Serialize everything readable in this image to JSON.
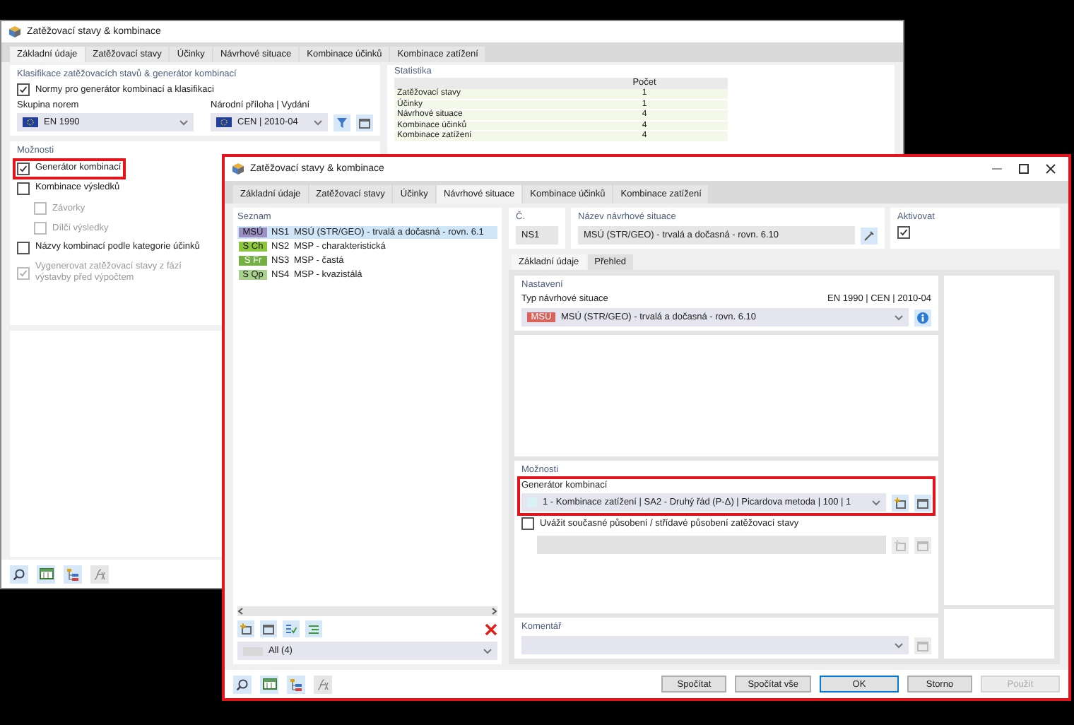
{
  "back_window": {
    "title": "Zatěžovací stavy & kombinace",
    "tabs": [
      {
        "label": "Základní údaje",
        "selected": true
      },
      {
        "label": "Zatěžovací stavy",
        "selected": false
      },
      {
        "label": "Účinky",
        "selected": false
      },
      {
        "label": "Návrhové situace",
        "selected": false
      },
      {
        "label": "Kombinace účinků",
        "selected": false
      },
      {
        "label": "Kombinace zatížení",
        "selected": false
      }
    ],
    "classification": {
      "heading": "Klasifikace zatěžovacích stavů & generátor kombinací",
      "norms": {
        "label": "Normy pro generátor kombinací a klasifikaci",
        "checked": true
      },
      "standard_group": {
        "label": "Skupina norem",
        "value": "EN 1990"
      },
      "national_annex": {
        "label": "Národní příloha | Vydání",
        "value": "CEN | 2010-04"
      }
    },
    "options": {
      "heading": "Možnosti",
      "items": [
        {
          "label": "Generátor kombinací",
          "checked": true,
          "disabled": false,
          "highlighted": true
        },
        {
          "label": "Kombinace výsledků",
          "checked": false,
          "disabled": false,
          "highlighted": false,
          "children": [
            {
              "label": "Závorky",
              "checked": false,
              "disabled": true
            },
            {
              "label": "Dílčí výsledky",
              "checked": false,
              "disabled": true
            }
          ]
        },
        {
          "label": "Názvy kombinací podle kategorie účinků",
          "checked": false,
          "disabled": false,
          "highlighted": false
        },
        {
          "label": "Vygenerovat zatěžovací stavy z fází výstavby před výpočtem",
          "checked": true,
          "disabled": true,
          "highlighted": false
        }
      ]
    },
    "statistics": {
      "heading": "Statistika",
      "column": "Počet",
      "rows": [
        {
          "label": "Zatěžovací stavy",
          "count": "1"
        },
        {
          "label": "Účinky",
          "count": "1"
        },
        {
          "label": "Návrhové situace",
          "count": "4"
        },
        {
          "label": "Kombinace účinků",
          "count": "4"
        },
        {
          "label": "Kombinace zatížení",
          "count": "4"
        }
      ]
    }
  },
  "front_window": {
    "title": "Zatěžovací stavy & kombinace",
    "highlighted": true,
    "tabs": [
      {
        "label": "Základní údaje",
        "selected": false
      },
      {
        "label": "Zatěžovací stavy",
        "selected": false
      },
      {
        "label": "Účinky",
        "selected": false
      },
      {
        "label": "Návrhové situace",
        "selected": true
      },
      {
        "label": "Kombinace účinků",
        "selected": false
      },
      {
        "label": "Kombinace zatížení",
        "selected": false
      }
    ],
    "list": {
      "heading": "Seznam",
      "items": [
        {
          "badge": "MSÚ",
          "color": "#9b8fc4",
          "code": "NS1",
          "name": "MSÚ (STR/GEO) - trvalá a dočasná - rovn. 6.1",
          "selected": true
        },
        {
          "badge": "S Ch",
          "color": "#8cc63f",
          "code": "NS2",
          "name": "MSP - charakteristická",
          "selected": false
        },
        {
          "badge": "S Fr",
          "color": "#74b043",
          "code": "NS3",
          "name": "MSP - častá",
          "selected": false
        },
        {
          "badge": "S Qp",
          "color": "#a9d18e",
          "code": "NS4",
          "name": "MSP - kvazistálá",
          "selected": false
        }
      ],
      "filter": "All (4)"
    },
    "number": {
      "label": "Č.",
      "value": "NS1"
    },
    "name": {
      "label": "Název návrhové situace",
      "value": "MSÚ (STR/GEO) - trvalá a dočasná - rovn. 6.10"
    },
    "activate": {
      "label": "Aktivovat",
      "checked": true
    },
    "subtabs": [
      {
        "label": "Základní údaje",
        "selected": true
      },
      {
        "label": "Přehled",
        "selected": false
      }
    ],
    "settings": {
      "heading": "Nastavení",
      "type_label": "Typ návrhové situace",
      "standard": "EN 1990 | CEN | 2010-04",
      "type": {
        "badge": "MSÚ",
        "color": "#d9625a",
        "value": "MSÚ (STR/GEO) - trvalá a dočasná - rovn. 6.10"
      }
    },
    "options": {
      "heading": "Možnosti",
      "generator": {
        "label": "Generátor kombinací",
        "value": "1 - Kombinace zatížení | SA2 - Druhý řád (P-Δ) | Picardova metoda | 100 | 1",
        "highlighted": true
      },
      "simultaneous": {
        "label": "Uvážit současné působení / střídavé působení zatěžovací stavy",
        "checked": false
      }
    },
    "comment": {
      "label": "Komentář"
    },
    "buttons": [
      {
        "label": "Spočítat",
        "kind": "normal"
      },
      {
        "label": "Spočítat vše",
        "kind": "normal"
      },
      {
        "label": "OK",
        "kind": "default"
      },
      {
        "label": "Storno",
        "kind": "normal"
      },
      {
        "label": "Použít",
        "kind": "disabled"
      }
    ]
  }
}
